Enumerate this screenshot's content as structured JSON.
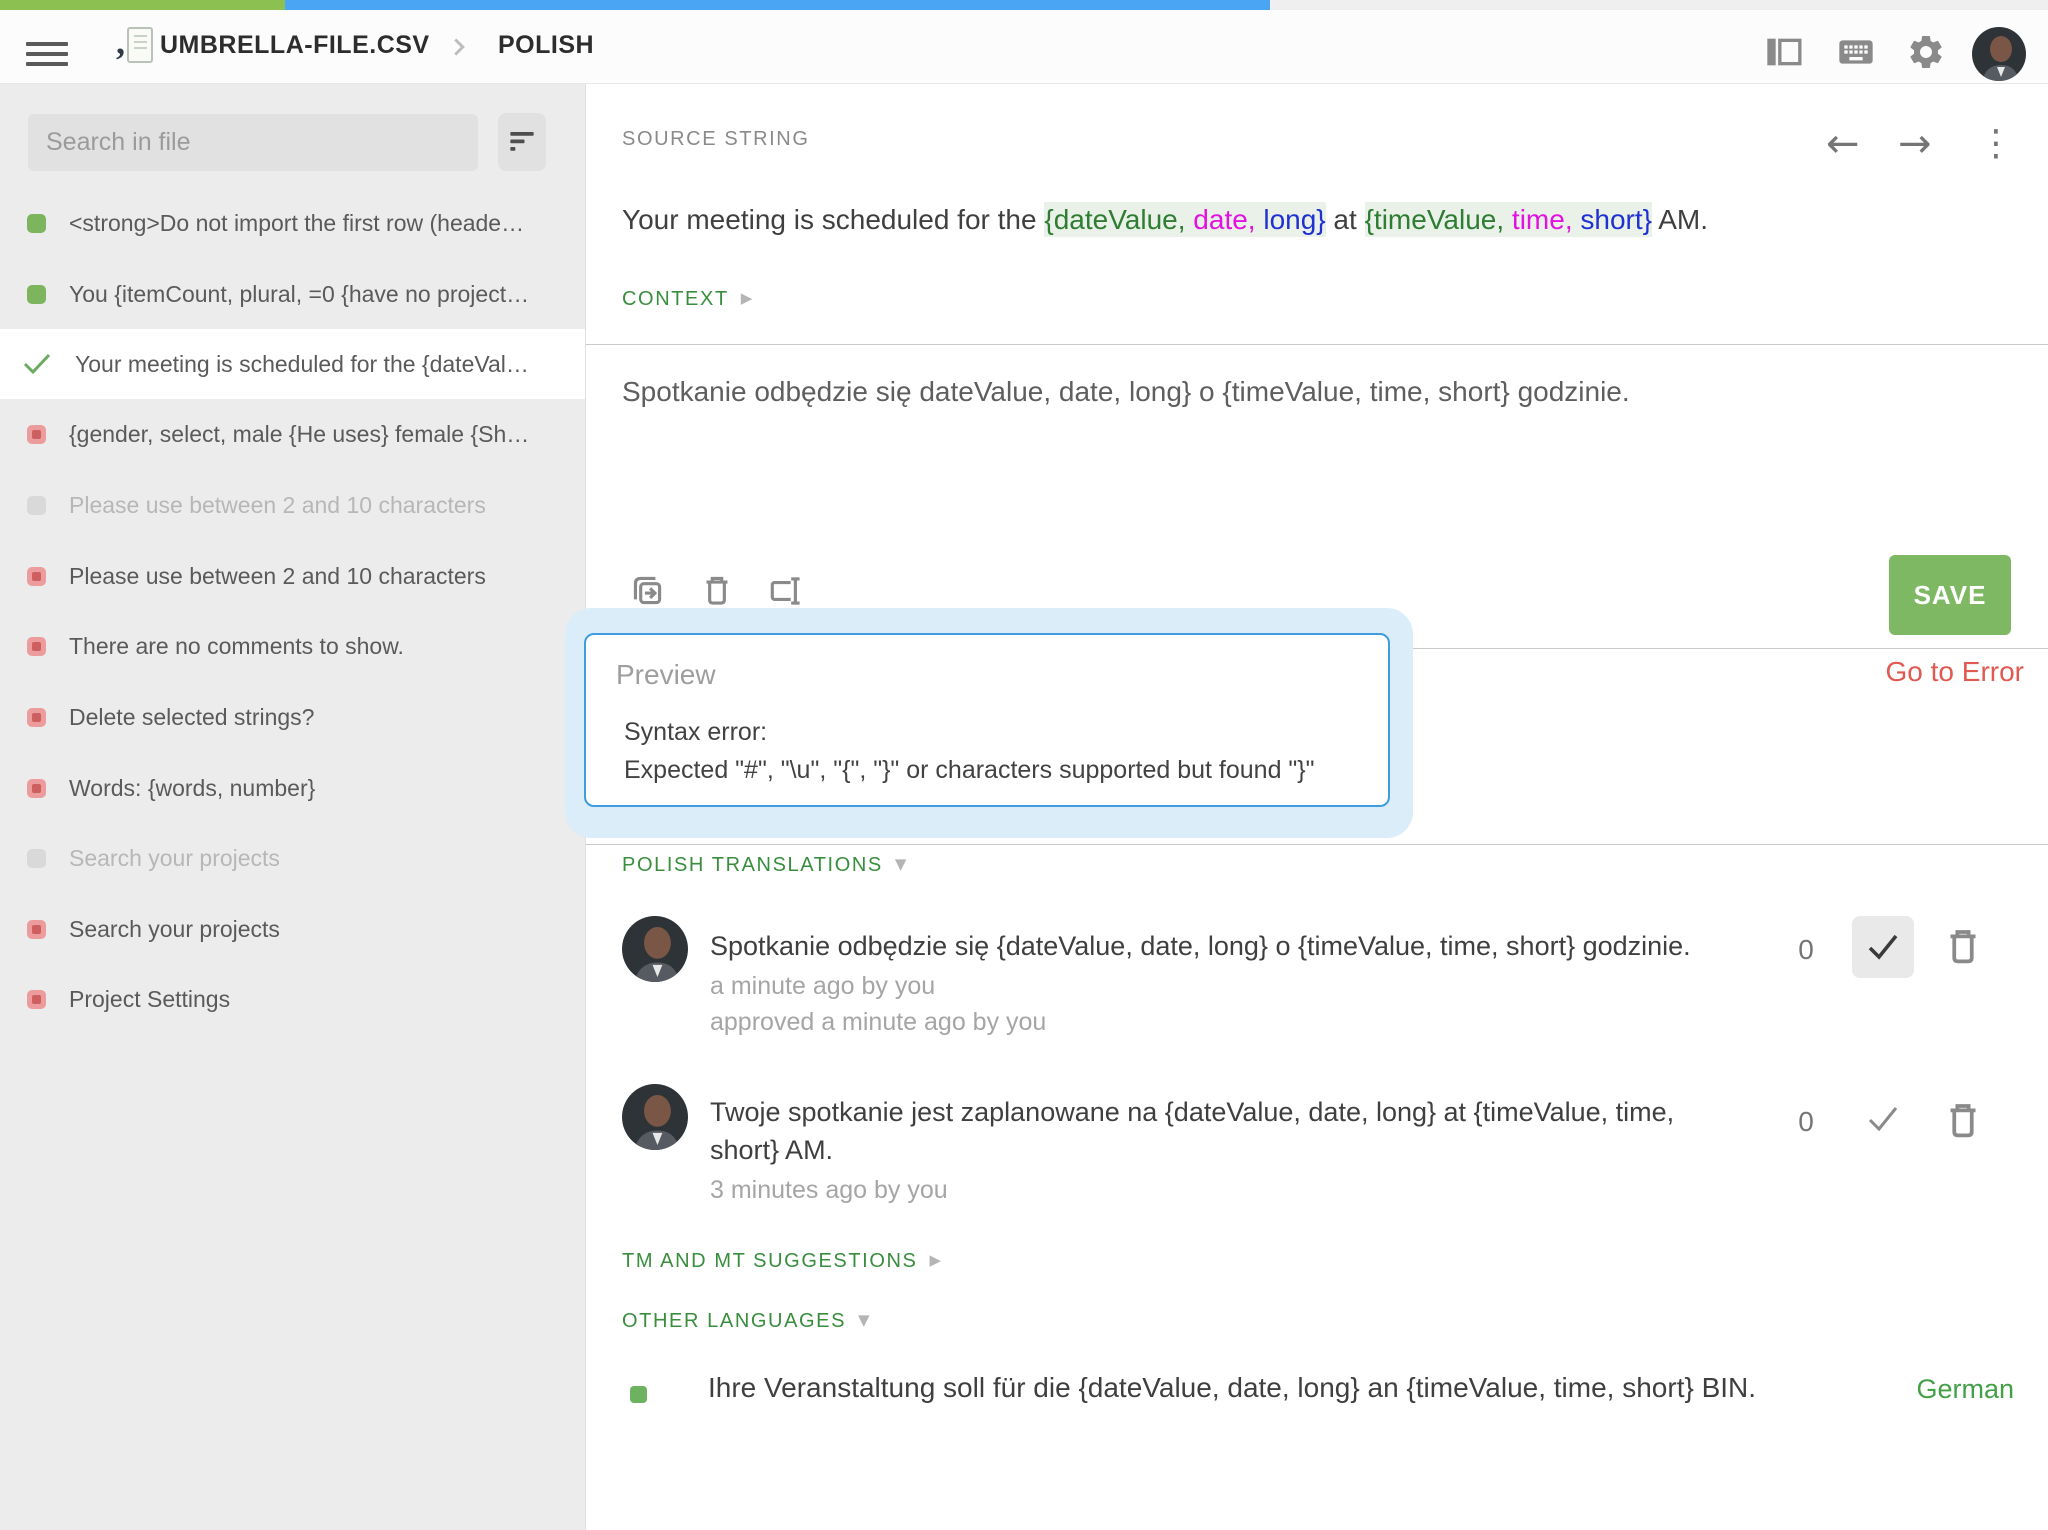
{
  "progress": {
    "approved_pct": 13.9,
    "translated_pct": 48.1,
    "approved_color": "#8CC152",
    "translated_color": "#4BA5F5"
  },
  "header": {
    "file_name": "UMBRELLA-FILE.CSV",
    "language": "POLISH"
  },
  "sidebar": {
    "search_placeholder": "Search in file",
    "items": [
      {
        "status": "approved",
        "label": "<strong>Do not import the first row (heade…"
      },
      {
        "status": "approved",
        "label": "You {itemCount, plural, =0 {have no project…"
      },
      {
        "status": "selected-approved",
        "label": "Your meeting is scheduled for the {dateVal…"
      },
      {
        "status": "untranslated",
        "label": "{gender, select, male {He uses} female {Sh…"
      },
      {
        "status": "hidden",
        "label": "Please use between 2 and 10 characters"
      },
      {
        "status": "untranslated",
        "label": "Please use between 2 and 10 characters"
      },
      {
        "status": "untranslated",
        "label": "There are no comments to show."
      },
      {
        "status": "untranslated",
        "label": "Delete selected strings?"
      },
      {
        "status": "untranslated",
        "label": "Words: {words, number}"
      },
      {
        "status": "hidden",
        "label": "Search your projects"
      },
      {
        "status": "untranslated",
        "label": "Search your projects"
      },
      {
        "status": "untranslated",
        "label": "Project Settings"
      }
    ]
  },
  "source": {
    "label": "SOURCE STRING",
    "segments": [
      {
        "text": "Your meeting is scheduled for the ",
        "style": "plain"
      },
      {
        "text": "{dateValue,",
        "style": "green"
      },
      {
        "text": " date,",
        "style": "magenta"
      },
      {
        "text": " long}",
        "style": "blue"
      },
      {
        "text": " at ",
        "style": "plain"
      },
      {
        "text": "{timeValue,",
        "style": "green"
      },
      {
        "text": " time,",
        "style": "magenta"
      },
      {
        "text": " short}",
        "style": "blue"
      },
      {
        "text": " AM.",
        "style": "plain"
      }
    ]
  },
  "context": {
    "label": "CONTEXT"
  },
  "editor": {
    "text": "Spotkanie odbędzie się dateValue, date, long} o {timeValue, time, short} godzinie.",
    "save_label": "SAVE",
    "go_to_error": "Go to Error"
  },
  "preview": {
    "label": "Preview",
    "error_line1": "Syntax error:",
    "error_line2": "Expected \"#\", \"\\u\", \"{\", \"}\" or characters supported but found \"}\""
  },
  "translations": {
    "label": "POLISH TRANSLATIONS",
    "items": [
      {
        "lines": [
          "Spotkanie odbędzie się {dateValue, date, long} o {timeValue, time, short} godzinie."
        ],
        "meta": [
          "a minute ago by you",
          "approved a minute ago by you"
        ],
        "votes": "0",
        "approved": true
      },
      {
        "lines": [
          "Twoje spotkanie jest zaplanowane na {dateValue, date, long} at {timeValue, time,",
          "short} AM."
        ],
        "meta": [
          "3 minutes ago by you"
        ],
        "votes": "0",
        "approved": false
      }
    ]
  },
  "suggestions": {
    "label": "TM AND MT SUGGESTIONS"
  },
  "other_languages": {
    "label": "OTHER LANGUAGES",
    "items": [
      {
        "text": "Ihre Veranstaltung soll für die {dateValue, date, long} an {timeValue, time, short} BIN.",
        "language": "German"
      }
    ]
  },
  "glyphs": {
    "back": "←",
    "forward": "→",
    "more": "⋮",
    "collapsed": "▶",
    "expanded": "▼",
    "check": "✓"
  }
}
